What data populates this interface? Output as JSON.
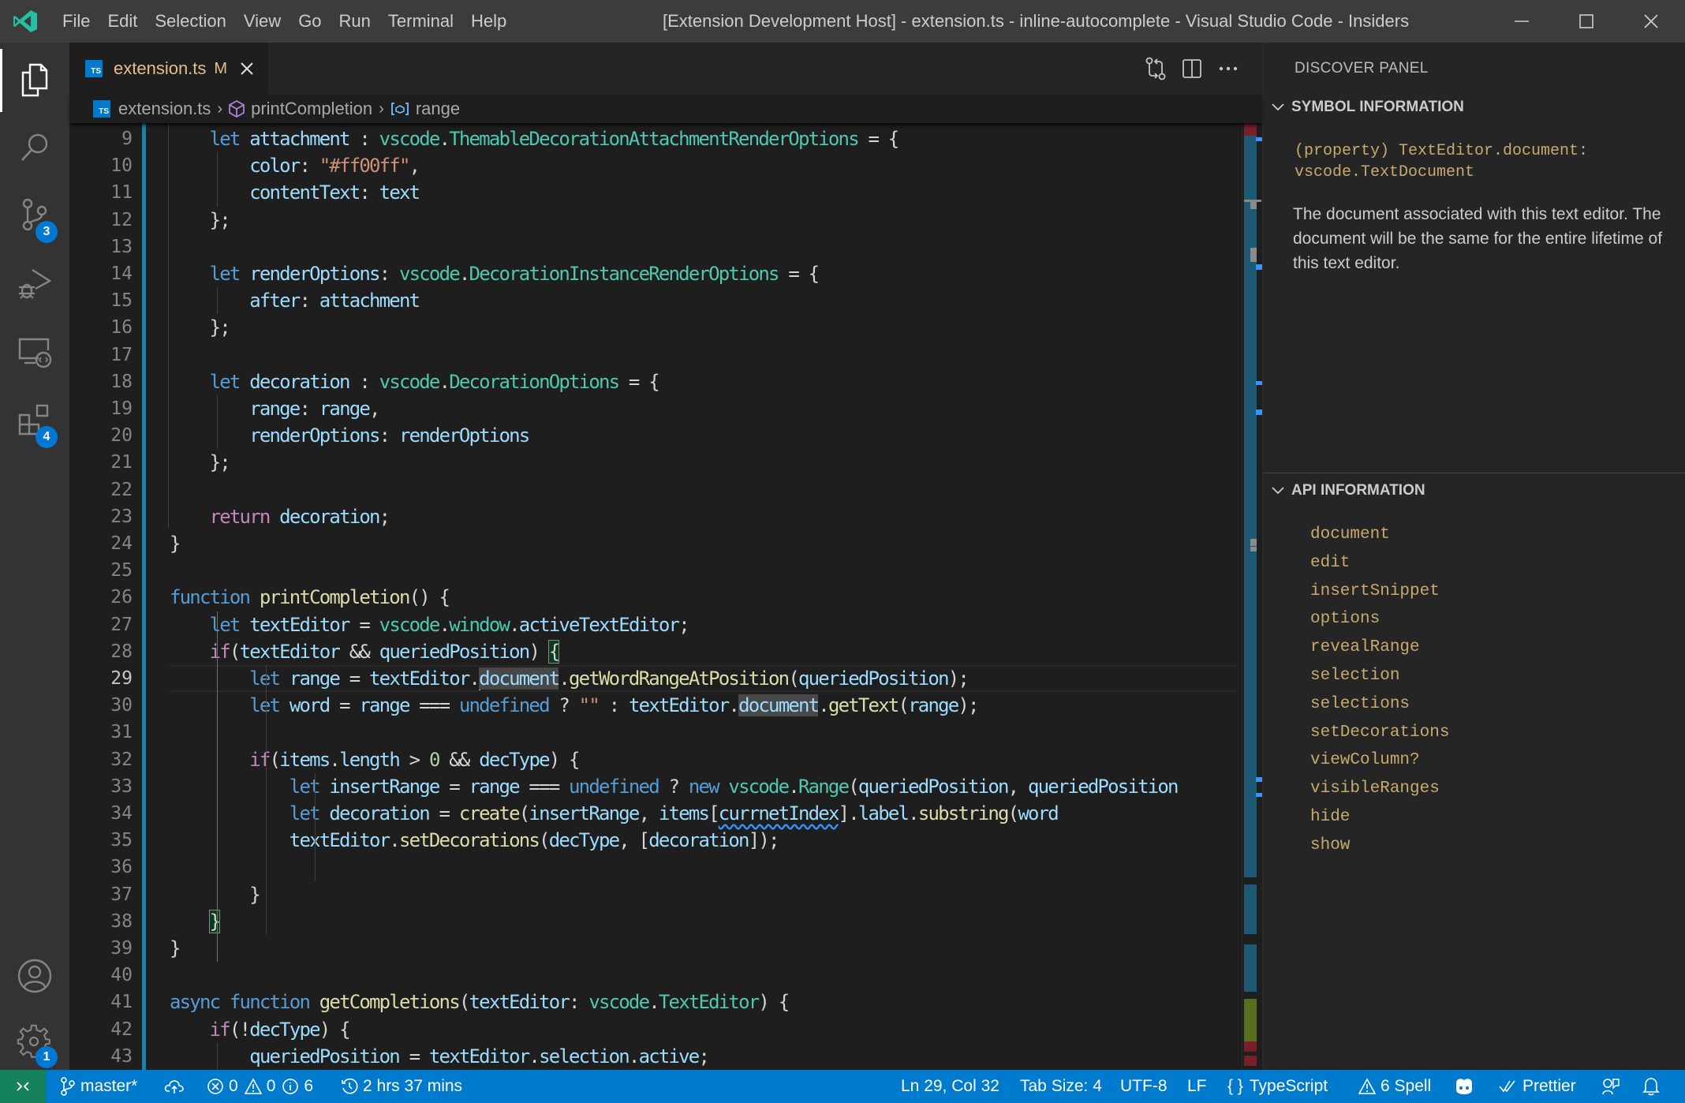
{
  "titlebar": {
    "menu": [
      "File",
      "Edit",
      "Selection",
      "View",
      "Go",
      "Run",
      "Terminal",
      "Help"
    ],
    "window_title": "[Extension Development Host] - extension.ts - inline-autocomplete - Visual Studio Code - Insiders",
    "controls": {
      "minimize": "—",
      "maximize": "☐",
      "close": "✕"
    }
  },
  "activity_bar": {
    "items": [
      {
        "name": "explorer",
        "icon": "files-icon",
        "active": true
      },
      {
        "name": "search",
        "icon": "search-icon"
      },
      {
        "name": "source-control",
        "icon": "source-control-icon",
        "badge": "3"
      },
      {
        "name": "run-and-debug",
        "icon": "debug-icon"
      },
      {
        "name": "remote-explorer",
        "icon": "remote-explorer-icon"
      },
      {
        "name": "extensions",
        "icon": "extensions-icon",
        "badge": "4"
      }
    ],
    "bottom": [
      {
        "name": "accounts",
        "icon": "account-icon"
      },
      {
        "name": "manage",
        "icon": "gear-icon",
        "badge": "1"
      }
    ]
  },
  "tabs": [
    {
      "label": "extension.ts",
      "icon_text": "TS",
      "modified": "M",
      "active": true
    }
  ],
  "breadcrumb": {
    "file": "extension.ts",
    "symbol": "printCompletion",
    "variable": "range"
  },
  "editor": {
    "current_line": 29,
    "lines": [
      {
        "n": "9"
      },
      {
        "n": "10"
      },
      {
        "n": "11"
      },
      {
        "n": "12"
      },
      {
        "n": "13"
      },
      {
        "n": "14"
      },
      {
        "n": "15"
      },
      {
        "n": "16"
      },
      {
        "n": "17"
      },
      {
        "n": "18"
      },
      {
        "n": "19"
      },
      {
        "n": "20"
      },
      {
        "n": "21"
      },
      {
        "n": "22"
      },
      {
        "n": "23"
      },
      {
        "n": "24"
      },
      {
        "n": "25"
      },
      {
        "n": "26"
      },
      {
        "n": "27"
      },
      {
        "n": "28"
      },
      {
        "n": "29"
      },
      {
        "n": "30"
      },
      {
        "n": "31"
      },
      {
        "n": "32"
      },
      {
        "n": "33"
      },
      {
        "n": "34"
      },
      {
        "n": "35"
      },
      {
        "n": "36"
      },
      {
        "n": "37"
      },
      {
        "n": "38"
      },
      {
        "n": "39"
      },
      {
        "n": "40"
      },
      {
        "n": "41"
      },
      {
        "n": "42"
      },
      {
        "n": "43"
      }
    ],
    "code": {
      "l9": [
        "    ",
        {
          "k": "kw",
          "t": "let"
        },
        " ",
        {
          "k": "va",
          "t": "attachment"
        },
        " : ",
        {
          "k": "ty",
          "t": "vscode"
        },
        ".",
        {
          "k": "ty",
          "t": "ThemableDecorationAttachmentRenderOptions"
        },
        " = {"
      ],
      "l10": [
        "        ",
        {
          "k": "va",
          "t": "color"
        },
        ": ",
        {
          "k": "st",
          "t": "\"#ff00ff\""
        },
        ","
      ],
      "l11": [
        "        ",
        {
          "k": "va",
          "t": "contentText"
        },
        ": ",
        {
          "k": "va",
          "t": "text"
        }
      ],
      "l12": [
        "    };"
      ],
      "l13": [
        ""
      ],
      "l14": [
        "    ",
        {
          "k": "kw",
          "t": "let"
        },
        " ",
        {
          "k": "va",
          "t": "renderOptions"
        },
        ": ",
        {
          "k": "ty",
          "t": "vscode"
        },
        ".",
        {
          "k": "ty",
          "t": "DecorationInstanceRenderOptions"
        },
        " = {"
      ],
      "l15": [
        "        ",
        {
          "k": "va",
          "t": "after"
        },
        ": ",
        {
          "k": "va",
          "t": "attachment"
        }
      ],
      "l16": [
        "    };"
      ],
      "l17": [
        ""
      ],
      "l18": [
        "    ",
        {
          "k": "kw",
          "t": "let"
        },
        " ",
        {
          "k": "va",
          "t": "decoration"
        },
        " : ",
        {
          "k": "ty",
          "t": "vscode"
        },
        ".",
        {
          "k": "ty",
          "t": "DecorationOptions"
        },
        " = {"
      ],
      "l19": [
        "        ",
        {
          "k": "va",
          "t": "range"
        },
        ": ",
        {
          "k": "va",
          "t": "range"
        },
        ","
      ],
      "l20": [
        "        ",
        {
          "k": "va",
          "t": "renderOptions"
        },
        ": ",
        {
          "k": "va",
          "t": "renderOptions"
        }
      ],
      "l21": [
        "    };"
      ],
      "l22": [
        ""
      ],
      "l23": [
        "    ",
        {
          "k": "ctl",
          "t": "return"
        },
        " ",
        {
          "k": "va",
          "t": "decoration"
        },
        ";"
      ],
      "l24": [
        "}"
      ],
      "l25": [
        ""
      ],
      "l26": [
        {
          "k": "kw",
          "t": "function"
        },
        " ",
        {
          "k": "fn",
          "t": "printCompletion"
        },
        "() {"
      ],
      "l27": [
        "    ",
        {
          "k": "kw",
          "t": "let"
        },
        " ",
        {
          "k": "va",
          "t": "textEditor"
        },
        " = ",
        {
          "k": "ty",
          "t": "vscode"
        },
        ".",
        {
          "k": "ty",
          "t": "window"
        },
        ".",
        {
          "k": "va",
          "t": "activeTextEditor"
        },
        ";"
      ],
      "l28": [
        "    ",
        {
          "k": "ctl",
          "t": "if"
        },
        "(",
        {
          "k": "va",
          "t": "textEditor"
        },
        " && ",
        {
          "k": "va",
          "t": "queriedPosition"
        },
        ") ",
        {
          "k": "bm",
          "t": "{"
        }
      ],
      "l29": [
        "        ",
        {
          "k": "kw",
          "t": "let"
        },
        " ",
        {
          "k": "va",
          "t": "range"
        },
        " = ",
        {
          "k": "va",
          "t": "textEditor"
        },
        ".",
        {
          "k": "cursor",
          "t": ""
        },
        {
          "k": "va hl",
          "t": "document"
        },
        ".",
        {
          "k": "fn",
          "t": "getWordRangeAtPosition"
        },
        "(",
        {
          "k": "va",
          "t": "queriedPosition"
        },
        ");"
      ],
      "l30": [
        "        ",
        {
          "k": "kw",
          "t": "let"
        },
        " ",
        {
          "k": "va",
          "t": "word"
        },
        " = ",
        {
          "k": "va",
          "t": "range"
        },
        " === ",
        {
          "k": "kw",
          "t": "undefined"
        },
        " ? ",
        {
          "k": "st",
          "t": "\"\""
        },
        " : ",
        {
          "k": "va",
          "t": "textEditor"
        },
        ".",
        {
          "k": "va hl",
          "t": "document"
        },
        ".",
        {
          "k": "fn",
          "t": "getText"
        },
        "(",
        {
          "k": "va",
          "t": "range"
        },
        ");"
      ],
      "l31": [
        ""
      ],
      "l32": [
        "        ",
        {
          "k": "ctl",
          "t": "if"
        },
        "(",
        {
          "k": "va",
          "t": "items"
        },
        ".",
        {
          "k": "va",
          "t": "length"
        },
        " > ",
        {
          "k": "nu",
          "t": "0"
        },
        " && ",
        {
          "k": "va",
          "t": "decType"
        },
        ") {"
      ],
      "l33": [
        "            ",
        {
          "k": "kw",
          "t": "let"
        },
        " ",
        {
          "k": "va",
          "t": "insertRange"
        },
        " = ",
        {
          "k": "va",
          "t": "range"
        },
        " === ",
        {
          "k": "kw",
          "t": "undefined"
        },
        " ? ",
        {
          "k": "kw",
          "t": "new"
        },
        " ",
        {
          "k": "ty",
          "t": "vscode"
        },
        ".",
        {
          "k": "ty",
          "t": "Range"
        },
        "(",
        {
          "k": "va",
          "t": "queriedPosition"
        },
        ", ",
        {
          "k": "va",
          "t": "queriedPosition"
        }
      ],
      "l34": [
        "            ",
        {
          "k": "kw",
          "t": "let"
        },
        " ",
        {
          "k": "va",
          "t": "decoration"
        },
        " = ",
        {
          "k": "fn",
          "t": "create"
        },
        "(",
        {
          "k": "va",
          "t": "insertRange"
        },
        ", ",
        {
          "k": "va",
          "t": "items"
        },
        "[",
        {
          "k": "va squig",
          "t": "currnetIndex"
        },
        "].",
        {
          "k": "va",
          "t": "label"
        },
        ".",
        {
          "k": "fn",
          "t": "substring"
        },
        "(",
        {
          "k": "va",
          "t": "word"
        }
      ],
      "l35": [
        "            ",
        {
          "k": "va",
          "t": "textEditor"
        },
        ".",
        {
          "k": "fn",
          "t": "setDecorations"
        },
        "(",
        {
          "k": "va",
          "t": "decType"
        },
        ", [",
        {
          "k": "va",
          "t": "decoration"
        },
        "]);"
      ],
      "l36": [
        ""
      ],
      "l37": [
        "        }"
      ],
      "l38": [
        "    ",
        {
          "k": "bm",
          "t": "}"
        }
      ],
      "l39": [
        "}"
      ],
      "l40": [
        ""
      ],
      "l41": [
        {
          "k": "kw",
          "t": "async"
        },
        " ",
        {
          "k": "kw",
          "t": "function"
        },
        " ",
        {
          "k": "fn",
          "t": "getCompletions"
        },
        "(",
        {
          "k": "va",
          "t": "textEditor"
        },
        ": ",
        {
          "k": "ty",
          "t": "vscode"
        },
        ".",
        {
          "k": "ty",
          "t": "TextEditor"
        },
        ") {"
      ],
      "l42": [
        "    ",
        {
          "k": "ctl",
          "t": "if"
        },
        "(!",
        {
          "k": "va",
          "t": "decType"
        },
        ") {"
      ],
      "l43": [
        "        ",
        {
          "k": "va",
          "t": "queriedPosition"
        },
        " = ",
        {
          "k": "va",
          "t": "textEditor"
        },
        ".",
        {
          "k": "va",
          "t": "selection"
        },
        ".",
        {
          "k": "va",
          "t": "active"
        },
        ";"
      ]
    }
  },
  "discover_panel": {
    "title": "DISCOVER PANEL",
    "symbol_section": {
      "header": "SYMBOL INFORMATION",
      "signature_line1": "(property) TextEditor.document:",
      "signature_line2": "vscode.TextDocument",
      "description": "The document associated with this text editor. The document will be the same for the entire lifetime of this text editor."
    },
    "api_section": {
      "header": "API INFORMATION",
      "items": [
        "document",
        "edit",
        "insertSnippet",
        "options",
        "revealRange",
        "selection",
        "selections",
        "setDecorations",
        "viewColumn?",
        "visibleRanges",
        "hide",
        "show"
      ]
    }
  },
  "statusbar": {
    "branch": "master*",
    "errors": "0",
    "warnings": "0",
    "infos": "6",
    "time_tracked": "2 hrs 37 mins",
    "cursor_position": "Ln 29, Col 32",
    "tab_size": "Tab Size: 4",
    "encoding": "UTF-8",
    "eol": "LF",
    "language": "TypeScript",
    "spell": "6 Spell",
    "prettier": "Prettier"
  },
  "colors": {
    "accent": "#007acc",
    "remote": "#16825d",
    "modified_tab": "#e2c08d",
    "api_text": "#c8a96e",
    "badge": "#0078d4"
  }
}
